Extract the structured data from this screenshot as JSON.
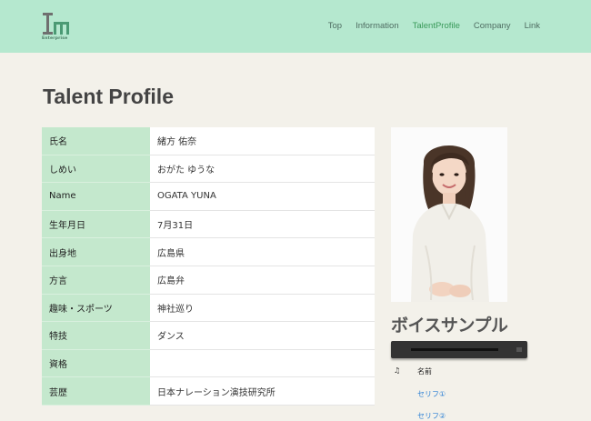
{
  "header": {
    "logo_sub": "Enterprise",
    "nav": [
      "Top",
      "Information",
      "TalentProfile",
      "Company",
      "Link"
    ],
    "active_nav": "TalentProfile"
  },
  "page_title": "Talent Profile",
  "profile": [
    {
      "label": "氏名",
      "value": "緒方 佑奈"
    },
    {
      "label": "しめい",
      "value": "おがた ゆうな"
    },
    {
      "label": "Name",
      "value": "OGATA YUNA"
    },
    {
      "label": "生年月日",
      "value": "7月31日"
    },
    {
      "label": "出身地",
      "value": "広島県"
    },
    {
      "label": "方言",
      "value": "広島弁"
    },
    {
      "label": "趣味・スポーツ",
      "value": "神社巡り"
    },
    {
      "label": "特技",
      "value": "ダンス"
    },
    {
      "label": "資格",
      "value": ""
    },
    {
      "label": "芸歴",
      "value": "日本ナレーション演技研究所"
    }
  ],
  "voice": {
    "title": "ボイスサンプル",
    "col_icon": "♫",
    "col_name": "名前",
    "tracks": [
      "セリフ①",
      "セリフ②"
    ]
  },
  "colors": {
    "header_bg": "#b5e8cf",
    "label_bg": "#c4e8cd",
    "page_bg": "#f3f1ea",
    "link": "#2a7fd4"
  },
  "icons": {
    "logo": "im-enterprise-logo",
    "track_column": "music-note-icon"
  }
}
